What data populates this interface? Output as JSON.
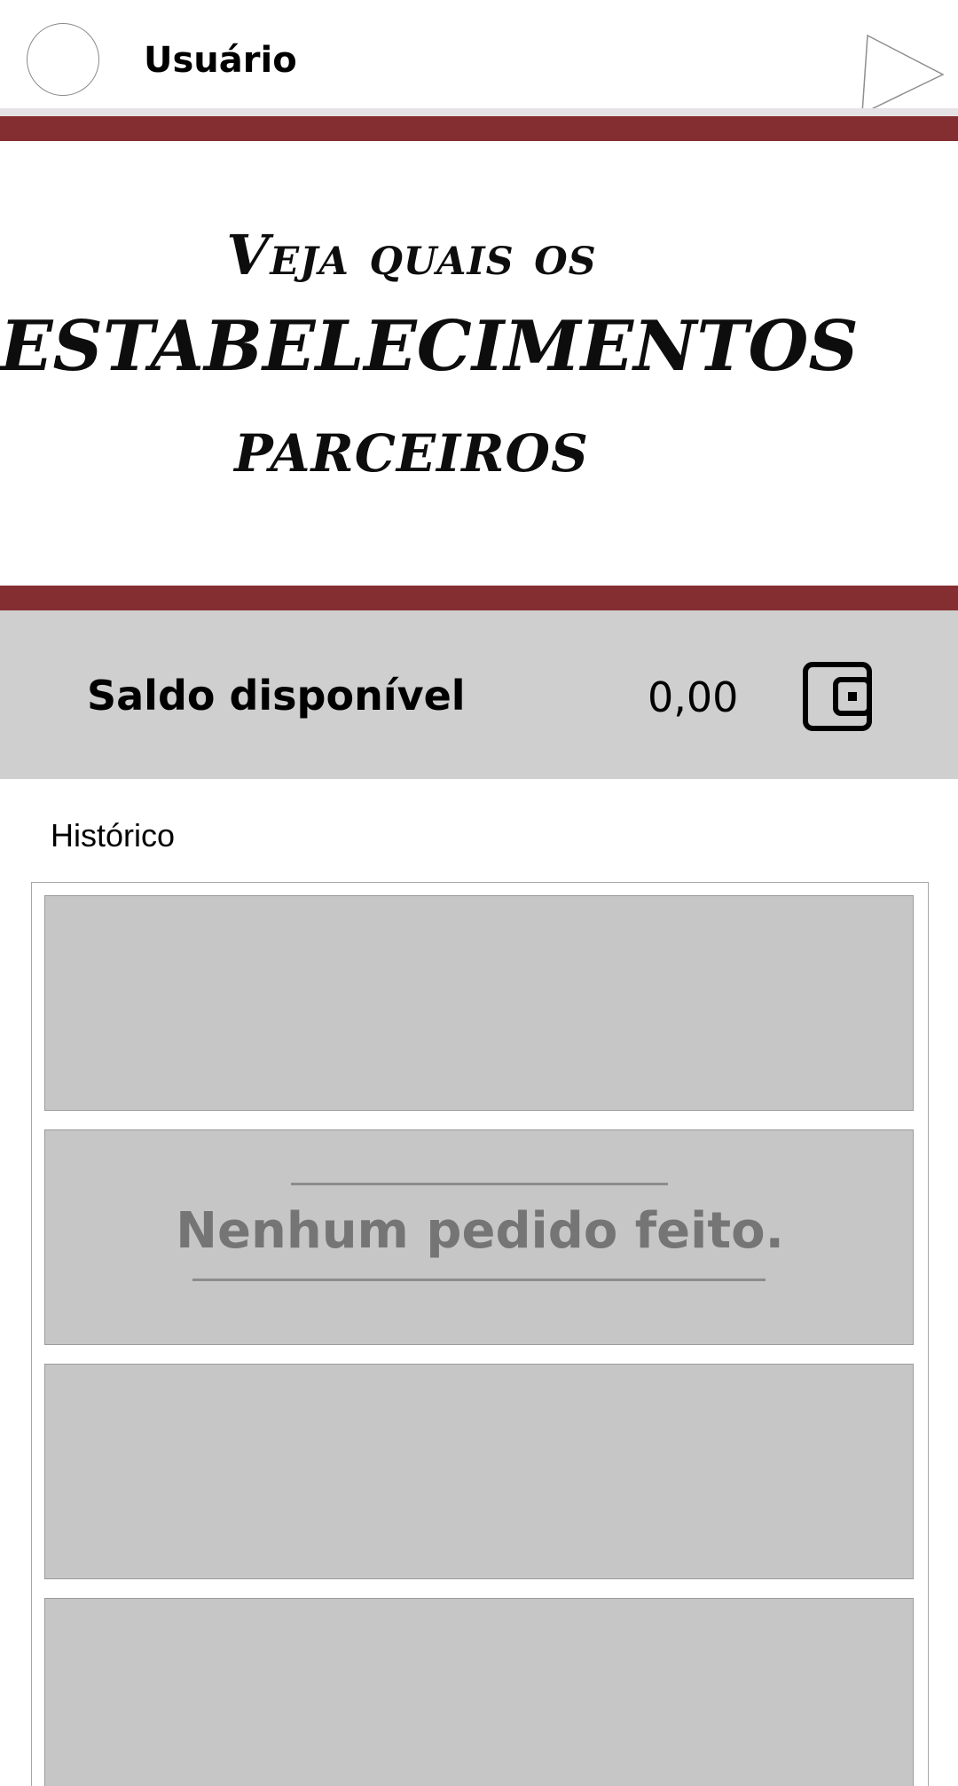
{
  "header": {
    "username": "Usuário",
    "avatar_icon": "user-avatar-circle",
    "play_icon": "play-triangle-icon"
  },
  "banner": {
    "line1": "Veja quais os",
    "line2": "ESTABELECIMENTOS",
    "line3": "PARCEIROS"
  },
  "balance": {
    "label": "Saldo disponível",
    "value": "0,00",
    "icon": "wallet-icon"
  },
  "history": {
    "title": "Histórico",
    "empty_message": "Nenhum pedido feito."
  },
  "colors": {
    "brand": "#852e31",
    "balance_bg": "#cfcfcf",
    "card_bg": "#c6c6c6",
    "empty_text": "#757575"
  }
}
